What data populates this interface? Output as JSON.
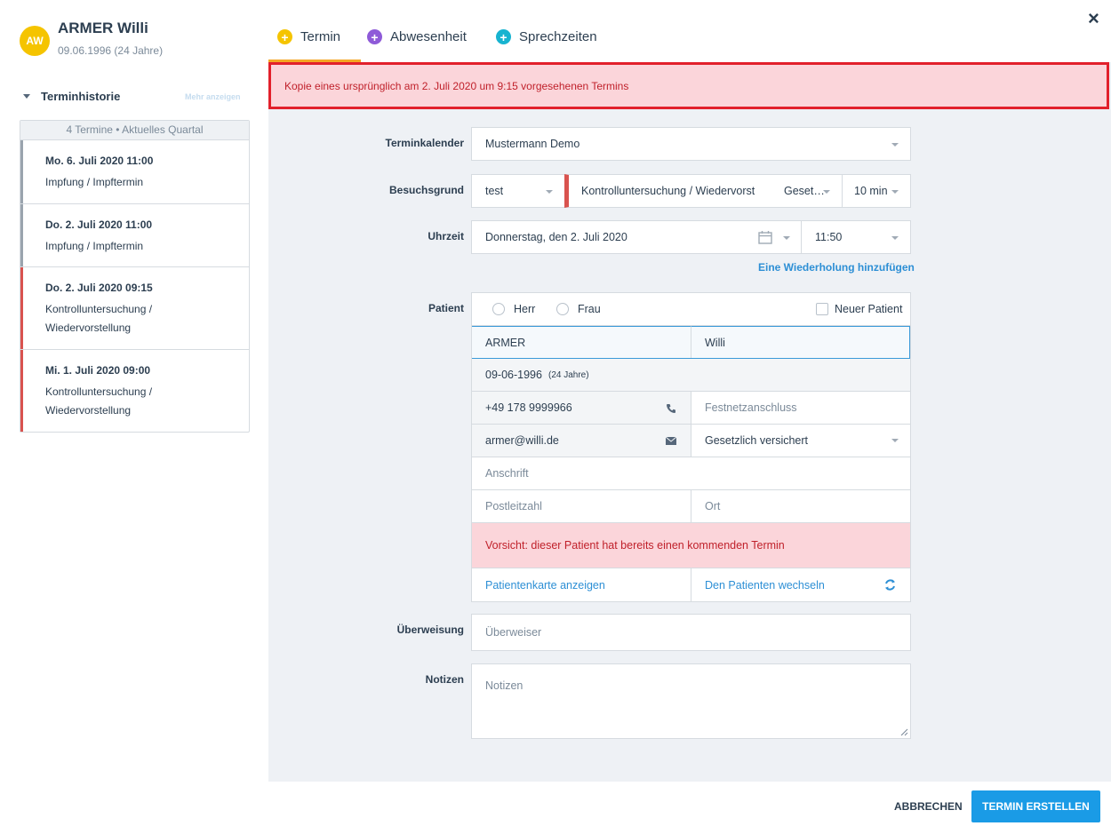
{
  "patient": {
    "initials": "AW",
    "name": "ARMER Willi",
    "dob": "09.06.1996 (24 Jahre)"
  },
  "history": {
    "title": "Terminhistorie",
    "more_link": "Mehr anzeigen",
    "summary": "4 Termine • Aktuelles Quartal",
    "items": [
      {
        "date": "Mo. 6. Juli 2020 11:00",
        "reason_line1": "Impfung / Impftermin",
        "reason_line2": "",
        "color": "#9aa4ae"
      },
      {
        "date": "Do. 2. Juli 2020 11:00",
        "reason_line1": "Impfung / Impftermin",
        "reason_line2": "",
        "color": "#9aa4ae"
      },
      {
        "date": "Do. 2. Juli 2020 09:15",
        "reason_line1": "Kontrolluntersuchung /",
        "reason_line2": "Wiedervorstellung",
        "color": "#d9534f"
      },
      {
        "date": "Mi. 1. Juli 2020 09:00",
        "reason_line1": "Kontrolluntersuchung /",
        "reason_line2": "Wiedervorstellung",
        "color": "#d9534f"
      }
    ]
  },
  "tabs": [
    {
      "label": "Termin",
      "color": "#f5c400"
    },
    {
      "label": "Abwesenheit",
      "color": "#8e5ad8"
    },
    {
      "label": "Sprechzeiten",
      "color": "#17b3d0"
    }
  ],
  "close_icon": "×",
  "copy_alert": "Kopie eines ursprünglich am 2. Juli 2020 um 9:15 vorgesehenen Termins",
  "form": {
    "calendar_label": "Terminkalender",
    "calendar_value": "Mustermann Demo",
    "reason_label": "Besuchsgrund",
    "reason_type": "test",
    "reason_value": "Kontrolluntersuchung / Wiedervorst",
    "reason_insurance": "Geset…",
    "reason_duration": "10 min",
    "reason_color": "#d9534f",
    "time_label": "Uhrzeit",
    "date_value": "Donnerstag, den 2. Juli 2020",
    "time_value": "11:50",
    "repeat_link": "Eine Wiederholung hinzufügen",
    "patient_label": "Patient",
    "salutation_mr": "Herr",
    "salutation_mrs": "Frau",
    "new_patient": "Neuer Patient",
    "last_name": "ARMER",
    "first_name": "Willi",
    "birthdate": "09-06-1996",
    "age": "(24 Jahre)",
    "phone": "+49 178 9999966",
    "landline_placeholder": "Festnetzanschluss",
    "email": "armer@willi.de",
    "insurance": "Gesetzlich versichert",
    "address_placeholder": "Anschrift",
    "zip_placeholder": "Postleitzahl",
    "city_placeholder": "Ort",
    "warning": "Vorsicht: dieser Patient hat bereits einen kommenden Termin",
    "show_card_link": "Patientenkarte anzeigen",
    "switch_patient_link": "Den Patienten wechseln",
    "referral_label": "Überweisung",
    "referral_placeholder": "Überweiser",
    "notes_label": "Notizen",
    "notes_placeholder": "Notizen"
  },
  "footer": {
    "cancel": "ABBRECHEN",
    "create": "TERMIN ERSTELLEN"
  }
}
